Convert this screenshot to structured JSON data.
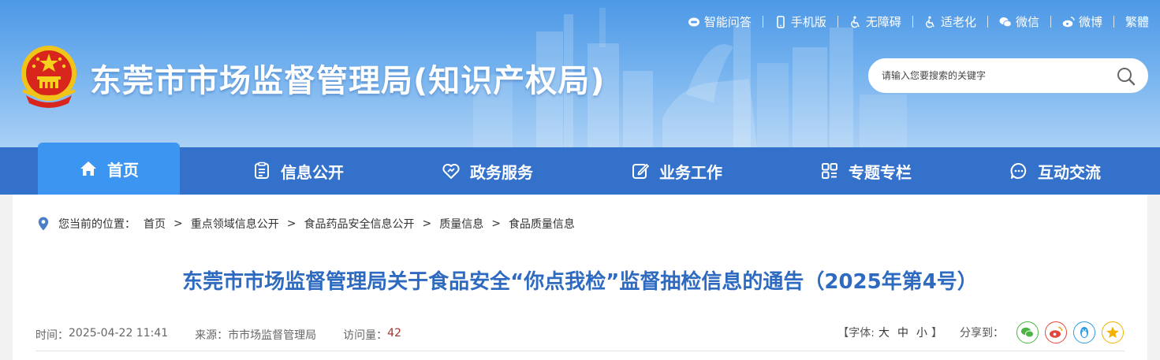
{
  "top_links": [
    {
      "label": "智能问答",
      "icon": "chat-robot-icon"
    },
    {
      "label": "手机版",
      "icon": "mobile-icon"
    },
    {
      "label": "无障碍",
      "icon": "accessibility-icon"
    },
    {
      "label": "适老化",
      "icon": "elderly-icon"
    },
    {
      "label": "微信",
      "icon": "wechat-icon"
    },
    {
      "label": "微博",
      "icon": "weibo-icon"
    },
    {
      "label": "繁體",
      "icon": ""
    }
  ],
  "site": {
    "title": "东莞市市场监督管理局(知识产权局)",
    "search_placeholder": "请输入您要搜索的关键字"
  },
  "nav": [
    {
      "label": "首页",
      "icon": "home-icon",
      "active": true
    },
    {
      "label": "信息公开",
      "icon": "document-list-icon",
      "active": false
    },
    {
      "label": "政务服务",
      "icon": "heart-hands-icon",
      "active": false
    },
    {
      "label": "业务工作",
      "icon": "edit-icon",
      "active": false
    },
    {
      "label": "专题专栏",
      "icon": "grid-icon",
      "active": false
    },
    {
      "label": "互动交流",
      "icon": "chat-bubble-icon",
      "active": false
    }
  ],
  "breadcrumb": {
    "label": "您当前的位置：",
    "items": [
      "首页",
      "重点领域信息公开",
      "食品药品安全信息公开",
      "质量信息",
      "食品质量信息"
    ],
    "separator": ">"
  },
  "article": {
    "title": "东莞市市场监督管理局关于食品安全“你点我检”监督抽检信息的通告（2025年第4号）",
    "time_label": "时间：",
    "time": "2025-04-22 11:41",
    "source_label": "来源：",
    "source": "市市场监督管理局",
    "visits_label": "访问量：",
    "visits": "42"
  },
  "tools": {
    "font_label_open": "【字体:",
    "font_large": "大",
    "font_medium": "中",
    "font_small": "小",
    "font_label_close": "】",
    "share_label": "分享到：",
    "share_targets": [
      {
        "name": "wechat",
        "color": "#4bb543"
      },
      {
        "name": "weibo",
        "color": "#e2473e"
      },
      {
        "name": "qq",
        "color": "#2d9be0"
      },
      {
        "name": "qzone",
        "color": "#f5b100"
      }
    ]
  },
  "colors": {
    "nav_bg": "#3471cb",
    "nav_active": "#3d95f2",
    "title_blue": "#2e6bc0",
    "visits_red": "#a3352c"
  }
}
